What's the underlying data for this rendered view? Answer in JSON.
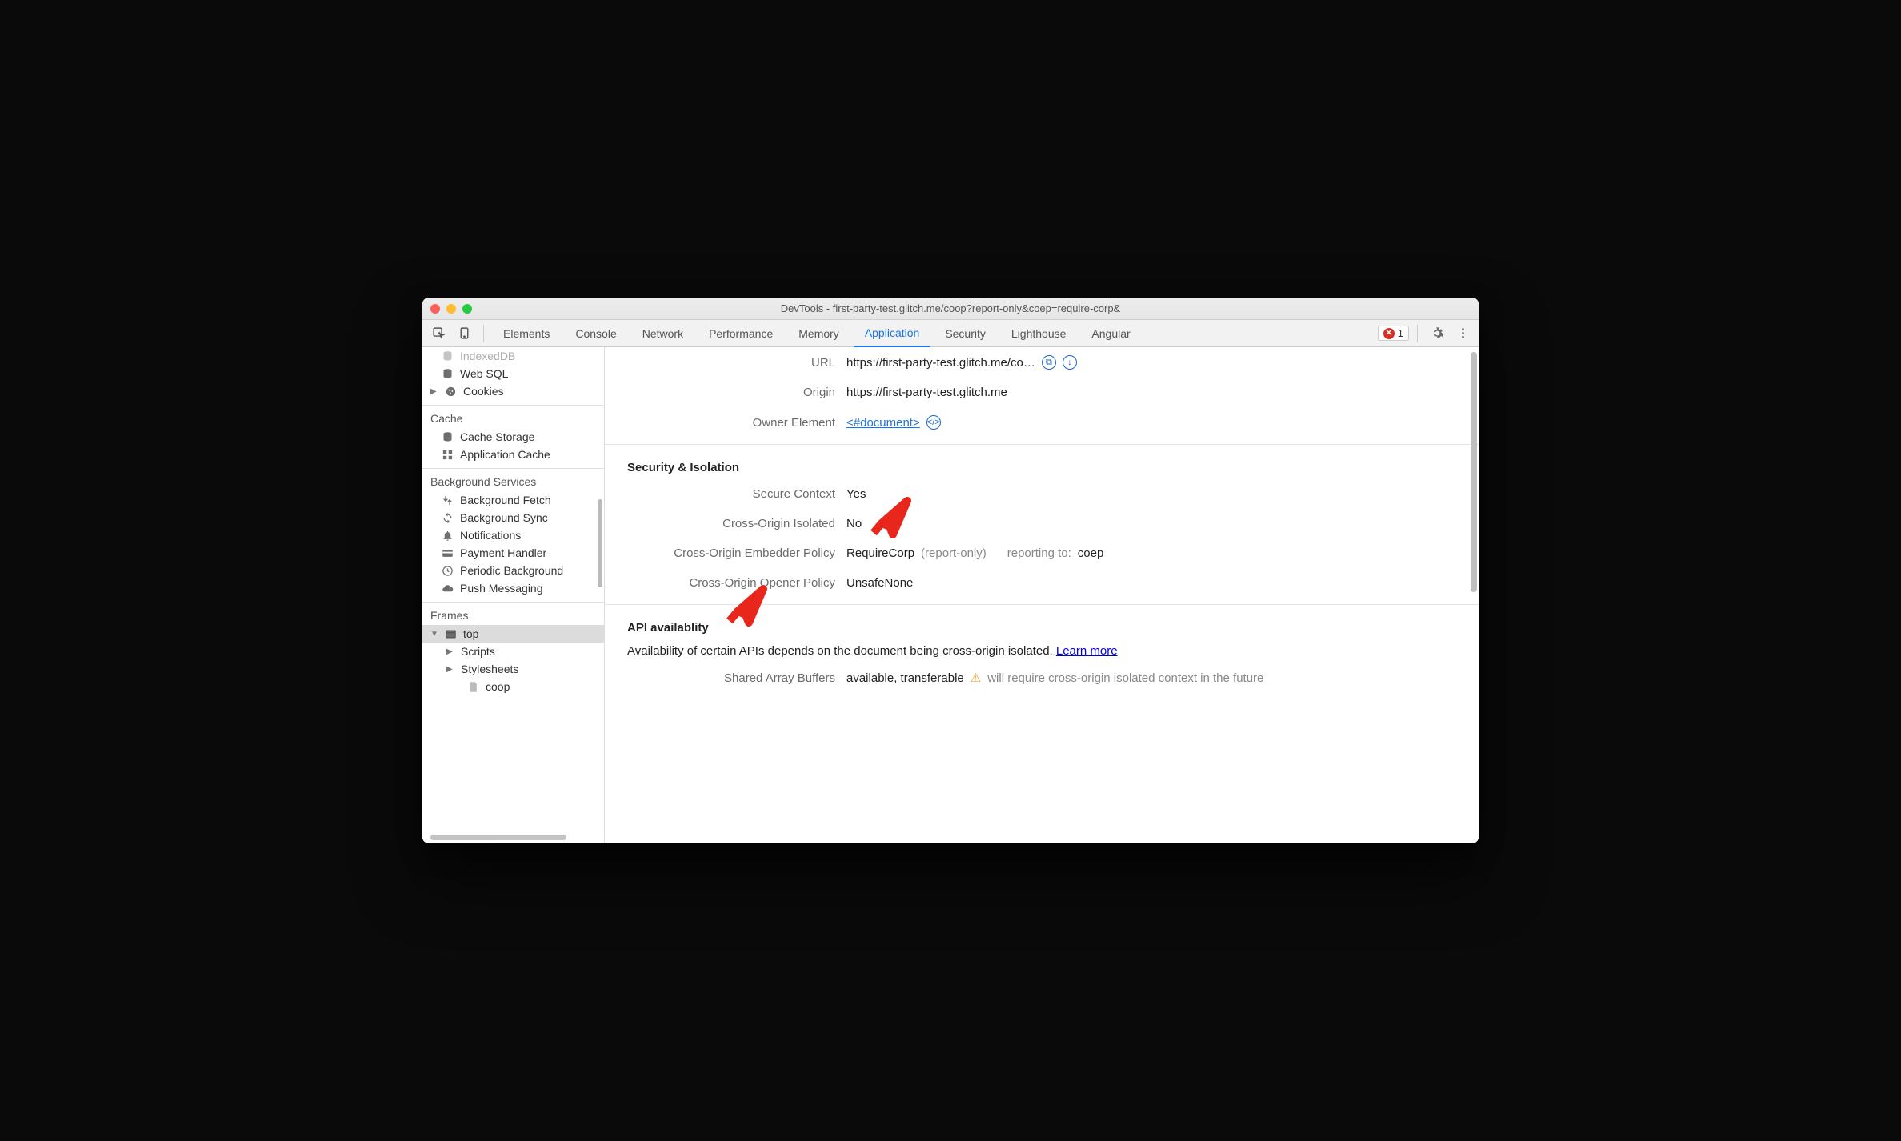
{
  "window": {
    "title": "DevTools - first-party-test.glitch.me/coop?report-only&coep=require-corp&"
  },
  "tabs": {
    "elements": "Elements",
    "console": "Console",
    "network": "Network",
    "performance": "Performance",
    "memory": "Memory",
    "application": "Application",
    "security": "Security",
    "lighthouse": "Lighthouse",
    "angular": "Angular"
  },
  "errors": {
    "count": "1"
  },
  "sidebar": {
    "storage": {
      "indexeddb": "IndexedDB",
      "websql": "Web SQL",
      "cookies": "Cookies"
    },
    "cache": {
      "title": "Cache",
      "cache_storage": "Cache Storage",
      "app_cache": "Application Cache"
    },
    "bg": {
      "title": "Background Services",
      "fetch": "Background Fetch",
      "sync": "Background Sync",
      "notif": "Notifications",
      "payment": "Payment Handler",
      "periodic": "Periodic Background",
      "push": "Push Messaging"
    },
    "frames": {
      "title": "Frames",
      "top": "top",
      "scripts": "Scripts",
      "stylesheets": "Stylesheets",
      "coop": "coop"
    }
  },
  "main": {
    "url_label": "URL",
    "url_value": "https://first-party-test.glitch.me/co…",
    "origin_label": "Origin",
    "origin_value": "https://first-party-test.glitch.me",
    "owner_label": "Owner Element",
    "owner_link": "<#document>",
    "sec_title": "Security & Isolation",
    "secure_label": "Secure Context",
    "secure_value": "Yes",
    "coi_label": "Cross-Origin Isolated",
    "coi_value": "No",
    "coep_label": "Cross-Origin Embedder Policy",
    "coep_value": "RequireCorp",
    "coep_report_only": "(report-only)",
    "coep_reporting_label": "reporting to:",
    "coep_reporting_value": "coep",
    "coop_label": "Cross-Origin Opener Policy",
    "coop_value": "UnsafeNone",
    "api_title": "API availablity",
    "api_desc": "Availability of certain APIs depends on the document being cross-origin isolated. ",
    "api_learn": "Learn more",
    "sab_label": "Shared Array Buffers",
    "sab_value": "available, transferable",
    "sab_warn": "will require cross-origin isolated context in the future"
  }
}
